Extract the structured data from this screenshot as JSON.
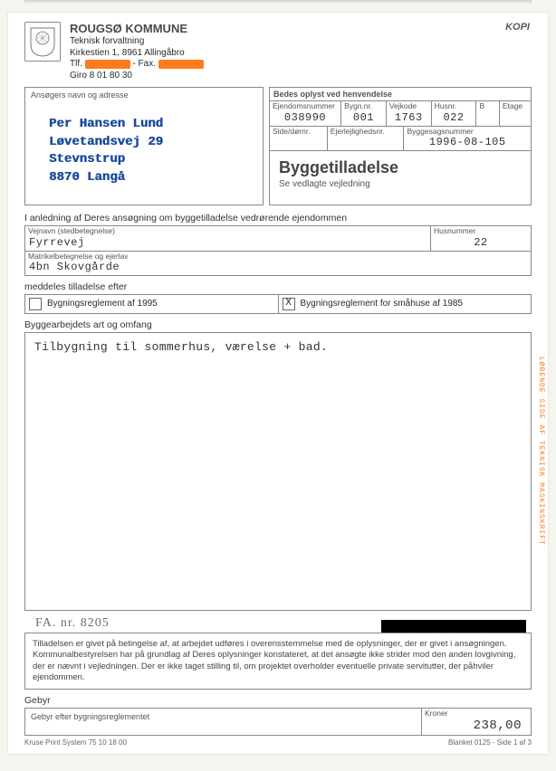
{
  "kopi_label": "KOPI",
  "org": {
    "name": "ROUGSØ KOMMUNE",
    "dept": "Teknisk forvaltning",
    "addr": "Kirkestien 1, 8961  Allingåbro",
    "tlf_prefix": "Tlf.",
    "fax_prefix": "- Fax.",
    "giro": "Giro 8 01 80 30"
  },
  "applicant": {
    "label": "Ansøgers navn og adresse",
    "lines": {
      "l1": "Per Hansen Lund",
      "l2": "Løvetandsvej  29",
      "l3": "Stevnstrup",
      "l4": "8870  Langå"
    }
  },
  "inquiry_head": "Bedes oplyst ved henvendelse",
  "row1": {
    "ejendom_lbl": "Ejendomsnummer",
    "ejendom_val": "038990",
    "bygn_lbl": "Bygn.nr.",
    "bygn_val": "001",
    "vejkode_lbl": "Vejkode",
    "vejkode_val": "1763",
    "husnr_lbl": "Husnr.",
    "husnr_val": "022",
    "b_lbl": "B",
    "b_val": "",
    "etage_lbl": "Etage",
    "etage_val": ""
  },
  "row2": {
    "side_lbl": "Side/dørnr.",
    "side_val": "",
    "ejer_lbl": "Ejerlejlighedsnr.",
    "ejer_val": "",
    "sag_lbl": "Byggesagsnummer",
    "sag_val": "1996-08-105"
  },
  "case": {
    "title": "Byggetilladelse",
    "sub": "Se vedlagte vejledning"
  },
  "property": {
    "intro": "I anledning af Deres ansøgning om byggetilladelse vedrørende ejendommen",
    "vej_lbl": "Vejnavn (stedbetegnelse)",
    "vej_val": "Fyrrevej",
    "husnr_lbl": "Husnummer",
    "husnr_val": "22",
    "matr_lbl": "Matrikelbetegnelse og ejerlav",
    "matr_val": "4bn Skovgårde"
  },
  "grant_after": "meddeles tilladelse efter",
  "reg1995": "Bygningsreglement af 1995",
  "reg1985": "Bygningsreglement for småhuse af 1985",
  "reg1985_checked": "X",
  "work": {
    "title": "Byggearbejdets art og omfang",
    "text": "Tilbygning til sommerhus, værelse + bad."
  },
  "handwritten": "FA. nr.   8205",
  "disclaimer": "Tilladelsen er givet på betingelse af, at arbejdet udføres i overensstemmelse med de oplysninger, der er givet i ansøgningen. Kommunalbestyrelsen har på grundlag af Deres oplysninger konstateret, at det ansøgte ikke strider mod den anden lovgivning, der er nævnt i vejledningen. Der er ikke taget stilling til, om projektet overholder eventuelle private servitutter, der påhviler ejendommen.",
  "gebyr": {
    "title": "Gebyr",
    "line_lbl": "Gebyr efter bygningsreglementet",
    "kroner_lbl": "Kroner",
    "kroner_val": "238,00"
  },
  "footer": {
    "left": "Kruse Print System 75 10 18 00",
    "right": "Blanket 0125 - Side 1 af 3"
  },
  "side_text": "LØBENDE SIDE AF TEKNISK MASKINSKRIFT"
}
